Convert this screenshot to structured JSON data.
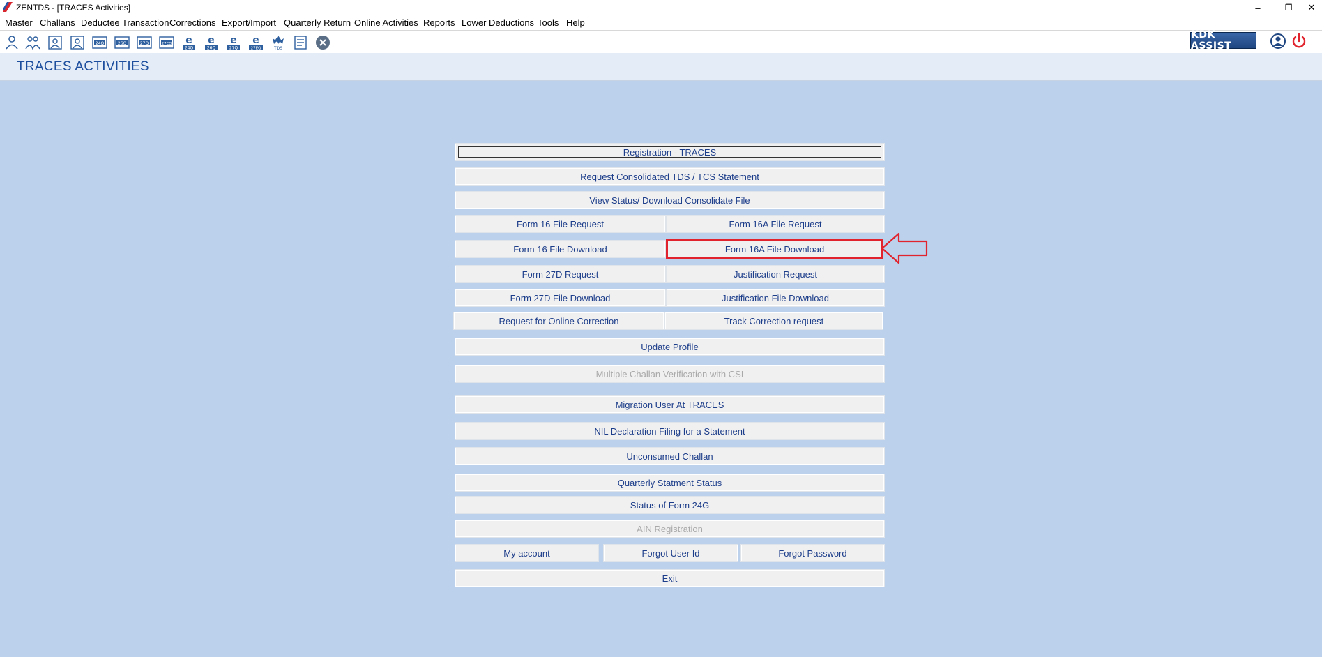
{
  "window": {
    "title": "ZENTDS - [TRACES Activities]",
    "minimize_glyph": "–",
    "restore_glyph": "❐",
    "close_glyph": "✕"
  },
  "menu": [
    "Master",
    "Challans",
    "Deductee Transaction",
    "Corrections",
    "Export/Import",
    "Quarterly Return",
    "Online Activities",
    "Reports",
    "Lower Deductions",
    "Tools",
    "Help"
  ],
  "toolbar": {
    "icons": [
      "deductor-icon",
      "deductee-icon",
      "employee-icon",
      "employee-2-icon",
      "form-24q-icon",
      "form-26q-icon",
      "form-27q-icon",
      "form-27eq-icon",
      "e-24q-icon",
      "e-26q-icon",
      "e-27q-icon",
      "e-27eq-icon",
      "tds-icon",
      "report-icon",
      "close-circle-icon"
    ],
    "icon_labels": [
      "",
      "",
      "",
      "",
      "24Q",
      "26Q",
      "27Q",
      "27EQ",
      "24Q",
      "26Q",
      "27Q",
      "27EQ",
      "TDS",
      "",
      ""
    ],
    "kdk_assist": "KDK ASSIST"
  },
  "page": {
    "title": "TRACES ACTIVITIES"
  },
  "buttons": {
    "registration": "Registration - TRACES",
    "request_consolidated": "Request Consolidated TDS / TCS Statement",
    "view_status": "View Status/ Download Consolidate File",
    "form16_request": "Form 16 File Request",
    "form16a_request": "Form 16A File Request",
    "form16_download": "Form 16 File Download",
    "form16a_download": "Form 16A File Download",
    "form27d_request": "Form 27D Request",
    "justification_request": "Justification Request",
    "form27d_download": "Form 27D File Download",
    "justification_download": "Justification File Download",
    "online_correction": "Request for Online Correction",
    "track_correction": "Track Correction request",
    "update_profile": "Update Profile",
    "multiple_challan": "Multiple Challan Verification with CSI",
    "migration_user": "Migration User At TRACES",
    "nil_declaration": "NIL Declaration Filing for a Statement",
    "unconsumed_challan": "Unconsumed Challan",
    "quarterly_status": "Quarterly Statment Status",
    "status_24g": "Status of Form 24G",
    "ain_registration": "AIN Registration",
    "my_account": "My account",
    "forgot_user_id": "Forgot User Id",
    "forgot_password": "Forgot Password",
    "exit": "Exit"
  },
  "colors": {
    "background": "#bcd1ec",
    "header": "#e3ecf7",
    "title_text": "#1d4e9e",
    "button_text": "#1c3d8a",
    "highlight": "#e0232c"
  }
}
